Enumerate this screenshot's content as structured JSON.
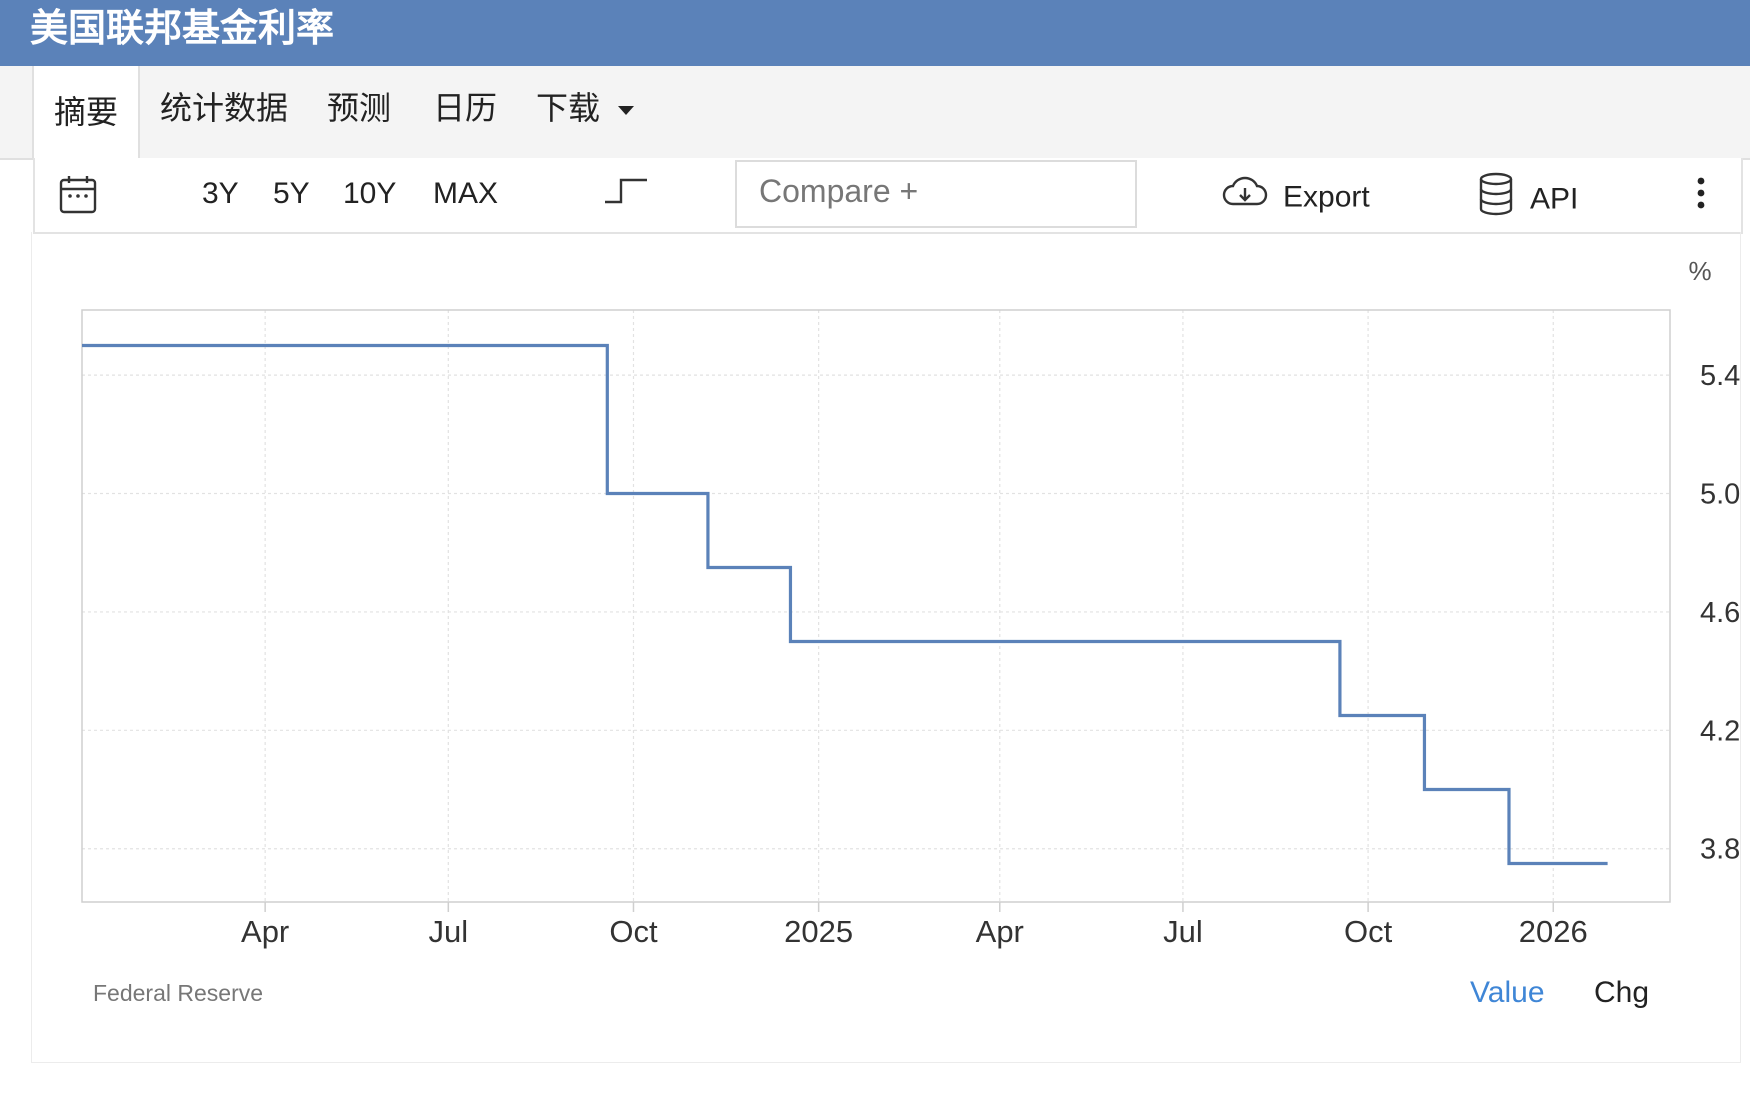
{
  "title": "美国联邦基金利率",
  "tabs": [
    {
      "label": "摘要"
    },
    {
      "label": "统计数据"
    },
    {
      "label": "预测"
    },
    {
      "label": "日历"
    },
    {
      "label": "下载"
    }
  ],
  "toolbar": {
    "ranges": [
      "3Y",
      "5Y",
      "10Y",
      "MAX"
    ],
    "compare_placeholder": "Compare +",
    "export_label": "Export",
    "api_label": "API"
  },
  "icons": [
    "calendar-icon",
    "step-chart-icon",
    "cloud-download-icon",
    "database-icon",
    "more-vertical-icon",
    "caret-down-icon"
  ],
  "chart_data": {
    "type": "line",
    "style": "step",
    "unit_label": "%",
    "x_tick_labels": [
      "Apr",
      "Jul",
      "Oct",
      "2025",
      "Apr",
      "Jul",
      "Oct",
      "2026"
    ],
    "y_tick_labels": [
      "5.4",
      "5.0",
      "4.6",
      "4.2",
      "3.8"
    ],
    "ylim": [
      3.62,
      5.62
    ],
    "grid": true,
    "y_axis_position": "right",
    "line_color": "#5b82b9",
    "series": [
      {
        "points": [
          {
            "x": "2024-01-01",
            "y": 5.5
          },
          {
            "x": "2024-09-18",
            "y": 5.0
          },
          {
            "x": "2024-11-07",
            "y": 4.75
          },
          {
            "x": "2024-12-18",
            "y": 4.5
          },
          {
            "x": "2025-09-17",
            "y": 4.25
          },
          {
            "x": "2025-10-29",
            "y": 4.0
          },
          {
            "x": "2025-12-10",
            "y": 3.75
          },
          {
            "x": "2026-01-28",
            "y": 3.75
          }
        ]
      }
    ]
  },
  "footer": {
    "source": "Federal Reserve",
    "value_label": "Value",
    "chg_label": "Chg"
  }
}
